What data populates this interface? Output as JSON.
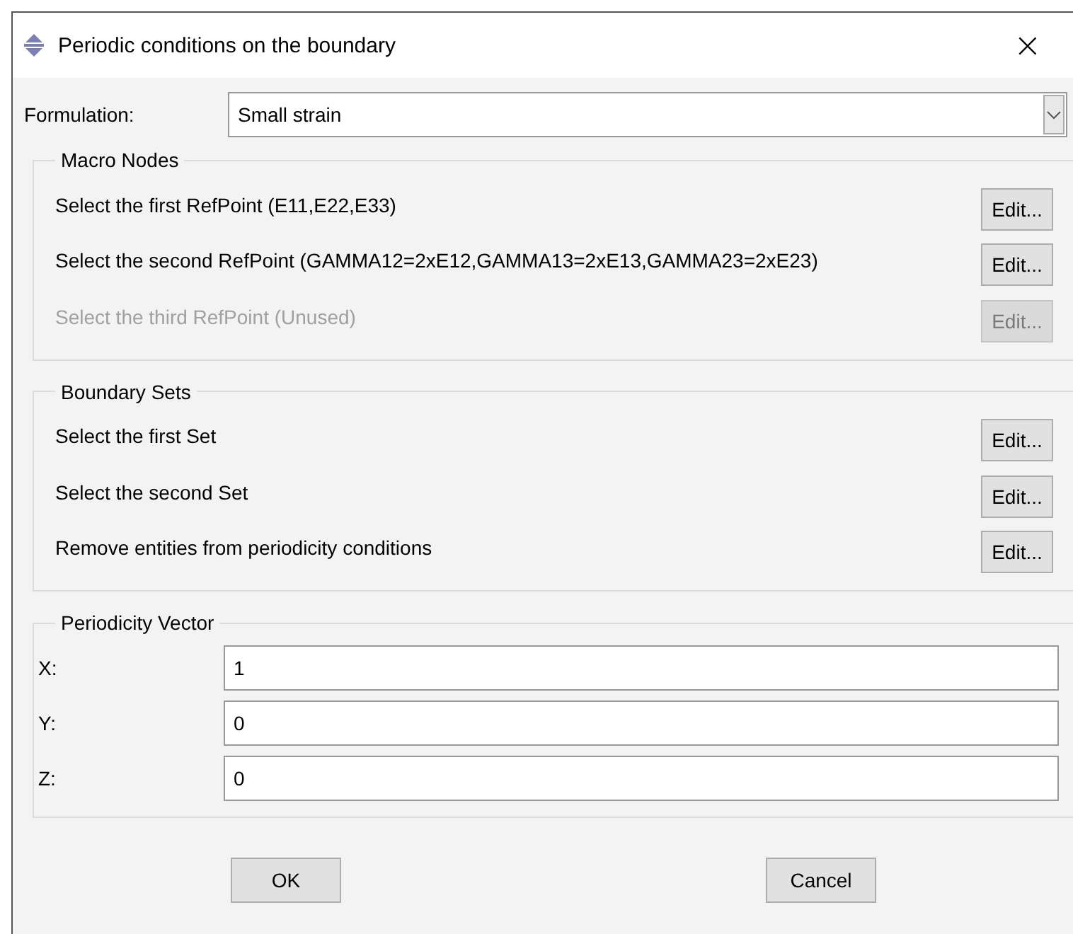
{
  "window": {
    "title": "Periodic conditions on the boundary",
    "close": "×"
  },
  "formulation": {
    "label": "Formulation:",
    "value": "Small strain"
  },
  "groups": [
    {
      "title": "Macro Nodes",
      "rows": [
        {
          "label": "Select the first RefPoint (E11,E22,E33)",
          "button": "Edit...",
          "disabled": false
        },
        {
          "label": "Select the second RefPoint (GAMMA12=2xE12,GAMMA13=2xE13,GAMMA23=2xE23)",
          "button": "Edit...",
          "disabled": false
        },
        {
          "label": "Select the third RefPoint (Unused)",
          "button": "Edit...",
          "disabled": true
        }
      ]
    },
    {
      "title": "Boundary Sets",
      "rows": [
        {
          "label": "Select the first Set",
          "button": "Edit...",
          "disabled": false
        },
        {
          "label": "Select the second Set",
          "button": "Edit...",
          "disabled": false
        },
        {
          "label": "Remove entities from periodicity conditions",
          "button": "Edit...",
          "disabled": false
        }
      ]
    }
  ],
  "vector": {
    "title": "Periodicity Vector",
    "fields": [
      {
        "label": "X:",
        "value": "1"
      },
      {
        "label": "Y:",
        "value": "0"
      },
      {
        "label": "Z:",
        "value": "0"
      }
    ]
  },
  "buttons": [
    "OK",
    "Cancel"
  ]
}
